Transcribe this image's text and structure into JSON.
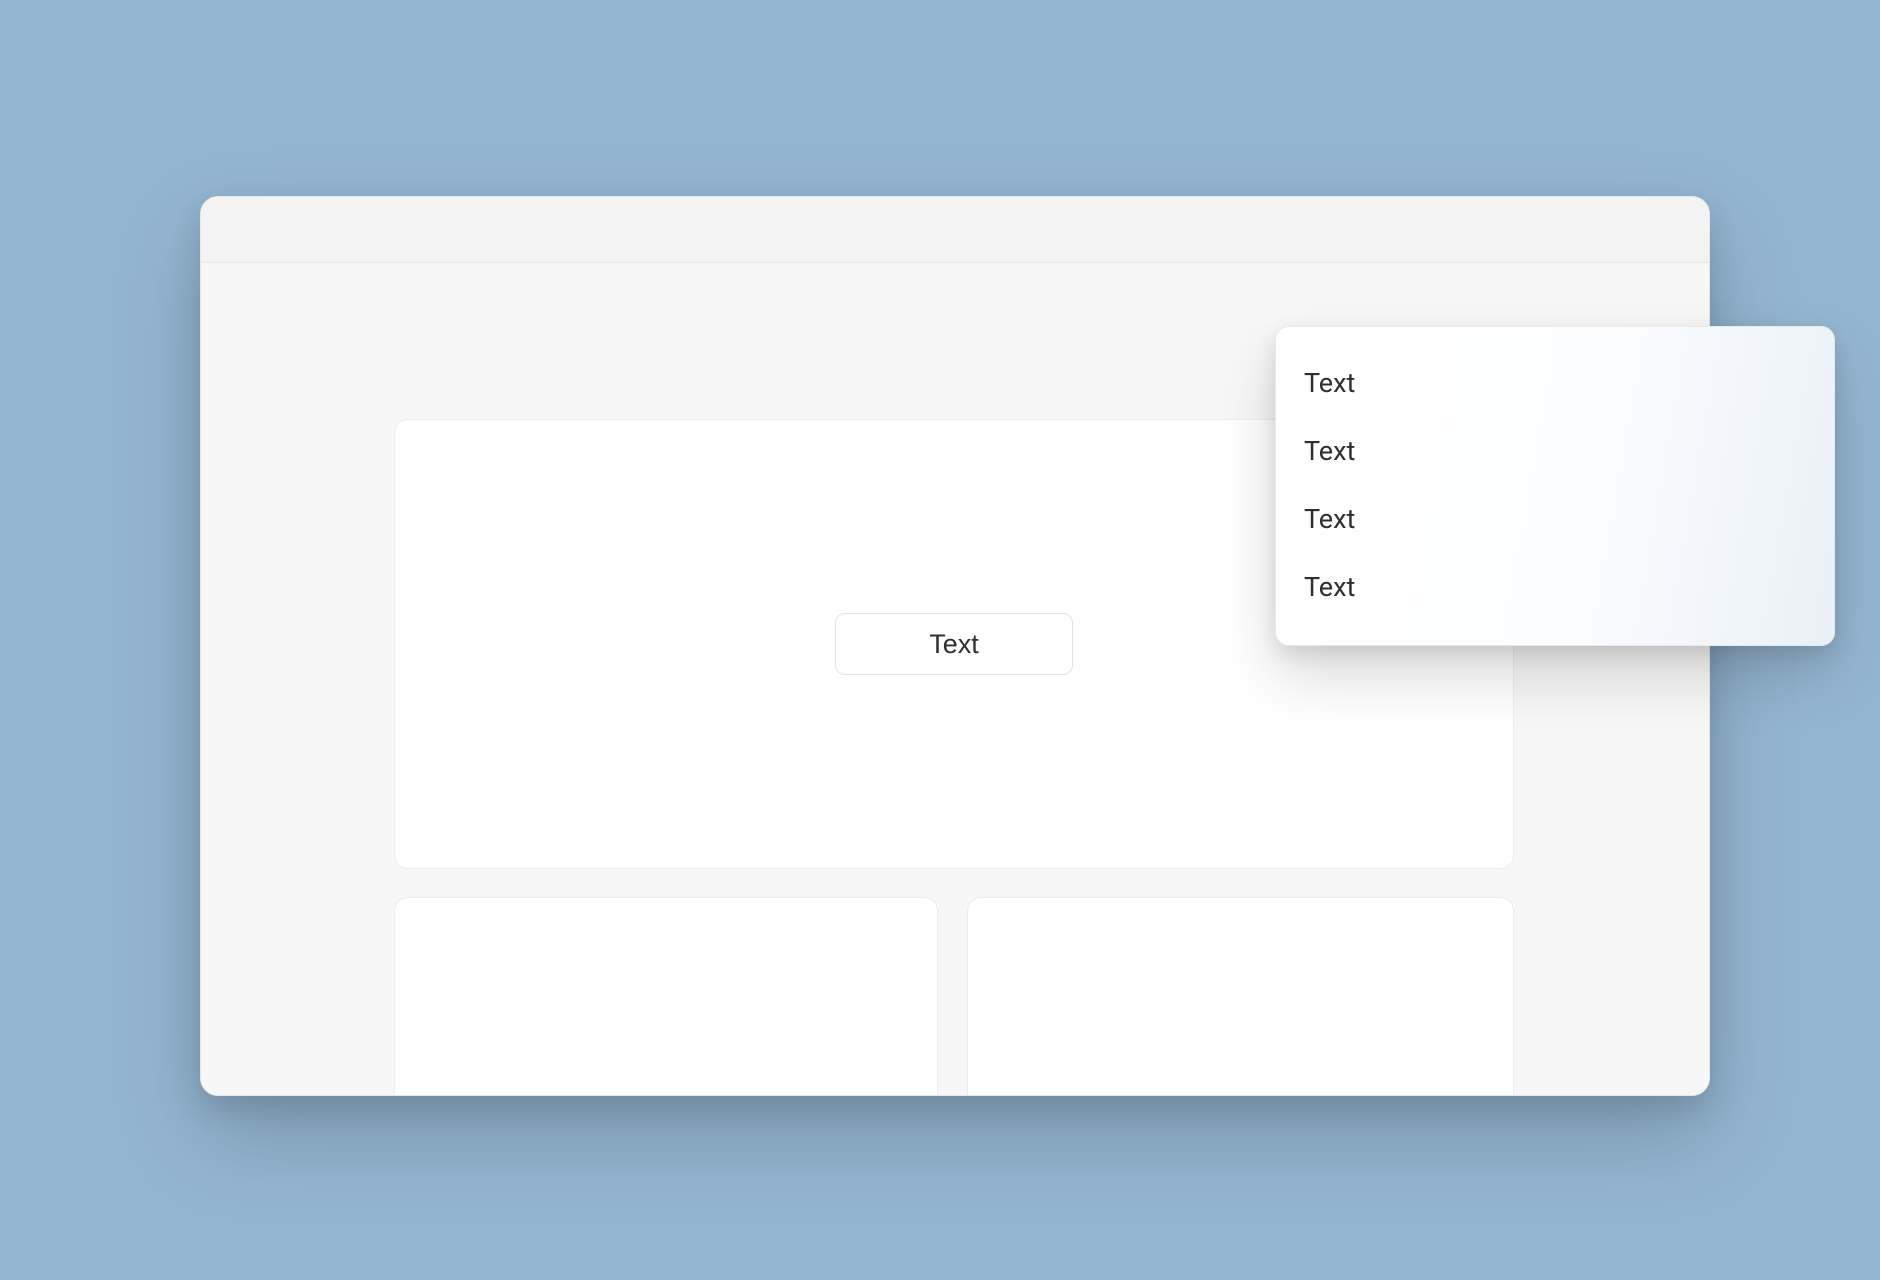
{
  "main": {
    "button_label": "Text"
  },
  "popover": {
    "items": [
      {
        "label": "Text"
      },
      {
        "label": "Text"
      },
      {
        "label": "Text"
      },
      {
        "label": "Text"
      }
    ]
  }
}
